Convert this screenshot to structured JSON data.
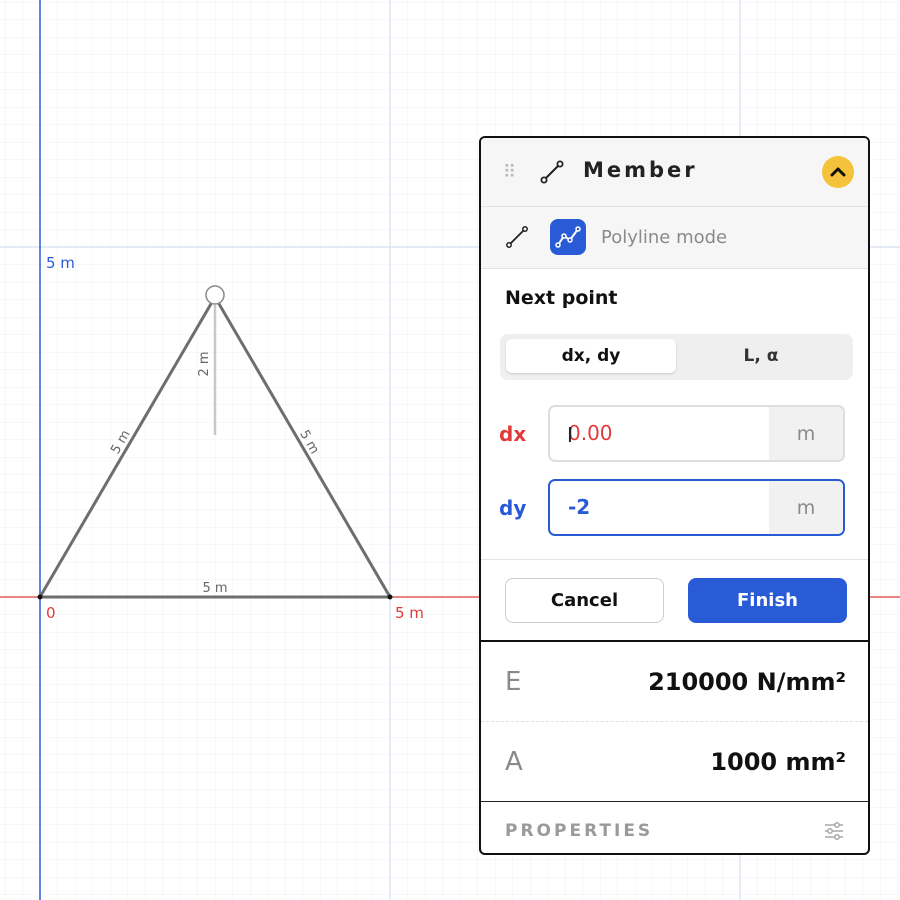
{
  "canvas": {
    "y_axis_label": "5 m",
    "origin_label": "0",
    "x_axis_label": "5 m",
    "member_labels": {
      "left": "5 m",
      "right": "5 m",
      "bottom": "5 m",
      "preview": "2 m"
    }
  },
  "panel": {
    "title": "Member",
    "mode_label": "Polyline mode",
    "next_point_title": "Next point",
    "tabs": [
      {
        "label": "dx, dy",
        "active": true
      },
      {
        "label": "L, α",
        "active": false
      }
    ],
    "dx": {
      "label": "dx",
      "value": "0.00",
      "unit": "m"
    },
    "dy": {
      "label": "dy",
      "value": "-2",
      "unit": "m"
    },
    "cancel_label": "Cancel",
    "finish_label": "Finish",
    "properties": [
      {
        "key": "E",
        "value": "210000 N/mm²"
      },
      {
        "key": "A",
        "value": "1000 mm²"
      }
    ],
    "footer_label": "PROPERTIES"
  },
  "colors": {
    "accent_blue": "#2a5bd7",
    "accent_red": "#e03a3a",
    "collapse_yellow": "#f5c33b",
    "grid": "#e6ecf5"
  }
}
